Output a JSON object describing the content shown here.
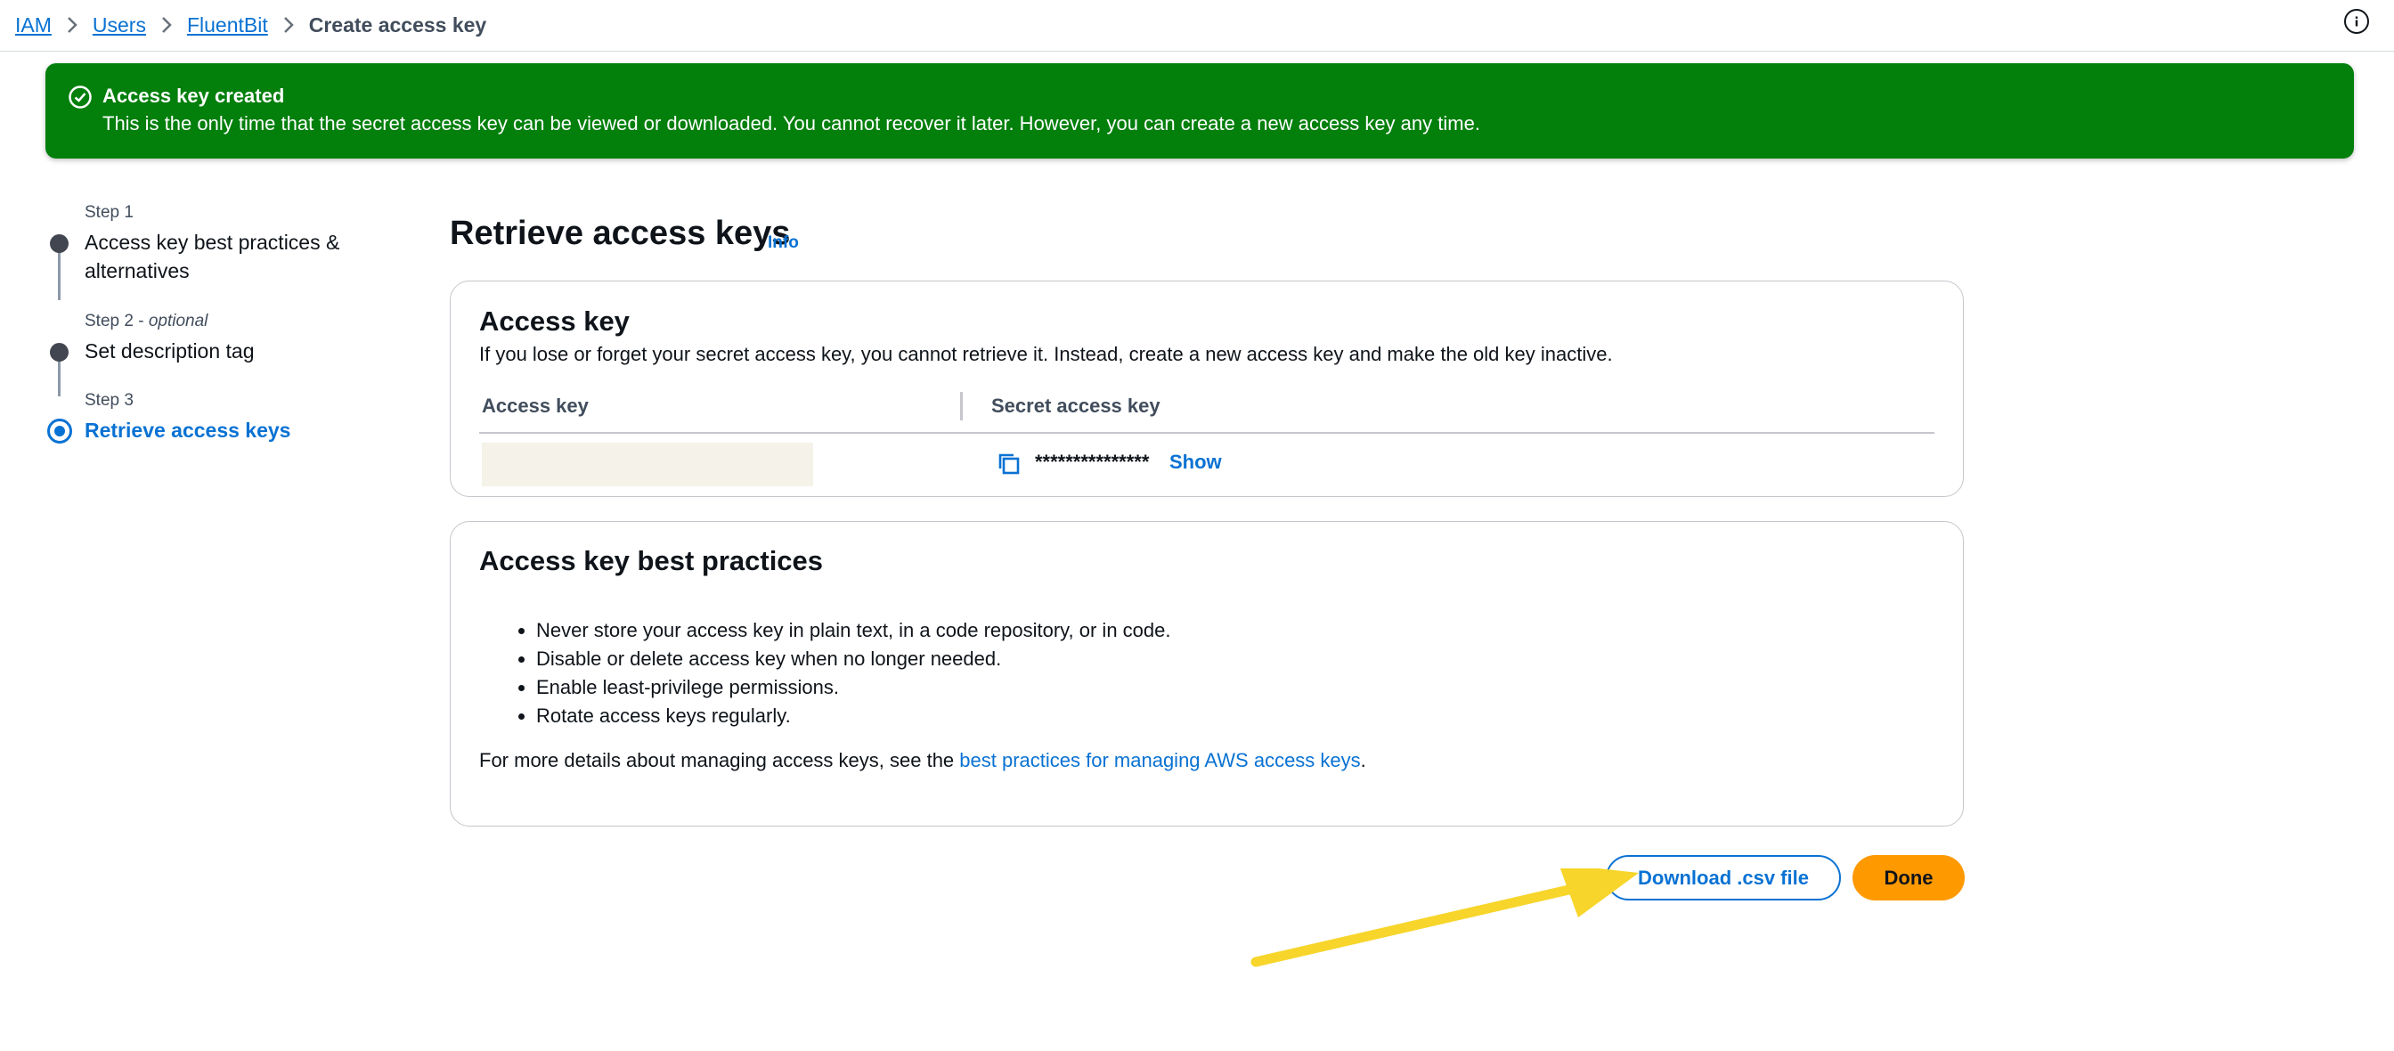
{
  "breadcrumb": {
    "items": [
      "IAM",
      "Users",
      "FluentBit"
    ],
    "current": "Create access key"
  },
  "banner": {
    "title": "Access key created",
    "message": "This is the only time that the secret access key can be viewed or downloaded. You cannot recover it later. However, you can create a new access key any time."
  },
  "steps": [
    {
      "number": "Step 1",
      "optional": "",
      "title": "Access key best practices & alternatives",
      "state": "completed"
    },
    {
      "number": "Step 2",
      "optional": "optional",
      "title": "Set description tag",
      "state": "completed"
    },
    {
      "number": "Step 3",
      "optional": "",
      "title": "Retrieve access keys",
      "state": "active"
    }
  ],
  "main": {
    "title": "Retrieve access keys",
    "info_label": "Info"
  },
  "access_key_card": {
    "heading": "Access key",
    "description": "If you lose or forget your secret access key, you cannot retrieve it. Instead, create a new access key and make the old key inactive.",
    "columns": [
      "Access key",
      "Secret access key"
    ],
    "secret_masked": "***************",
    "show_label": "Show"
  },
  "best_practices_card": {
    "heading": "Access key best practices",
    "items": [
      "Never store your access key in plain text, in a code repository, or in code.",
      "Disable or delete access key when no longer needed.",
      "Enable least-privilege permissions.",
      "Rotate access keys regularly."
    ],
    "more_prefix": "For more details about managing access keys, see the ",
    "more_link": "best practices for managing AWS access keys",
    "more_suffix": "."
  },
  "actions": {
    "download_label": "Download .csv file",
    "done_label": "Done"
  },
  "colors": {
    "link": "#0972d3",
    "success": "#037f0c",
    "primary_button": "#ff9900",
    "annotation_arrow": "#f7d52a"
  },
  "icons": [
    "chevron-right-icon",
    "info-icon",
    "success-check-icon",
    "copy-icon",
    "annotation-arrow"
  ]
}
